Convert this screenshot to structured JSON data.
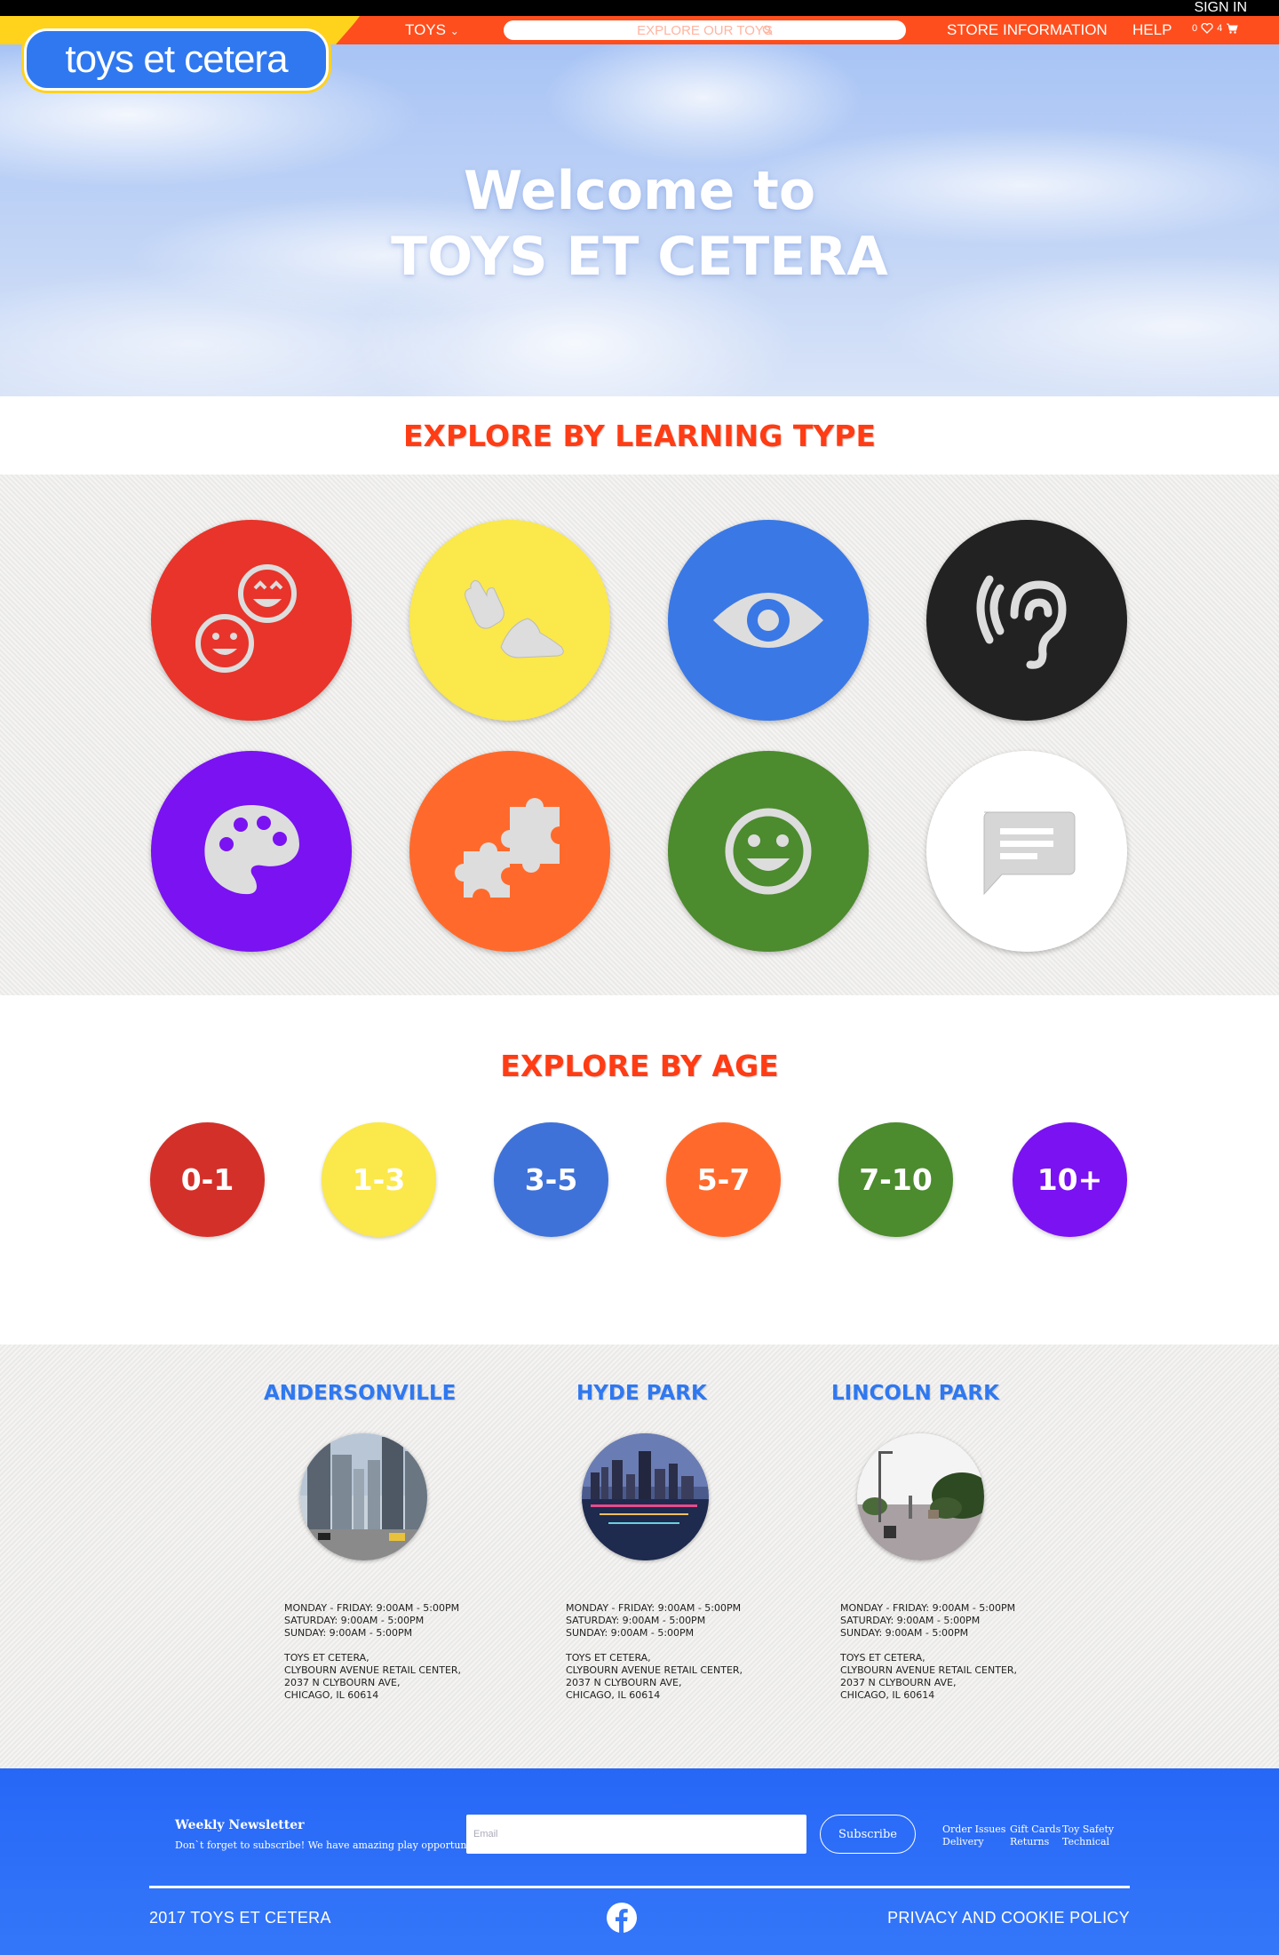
{
  "header": {
    "sign_in": "SIGN IN",
    "logo": "toys et cetera",
    "nav_toys": "TOYS",
    "search_placeholder": "EXPLORE OUR TOYS",
    "nav_store": "STORE INFORMATION",
    "nav_help": "HELP",
    "wishlist_count": "0",
    "cart_count": "4"
  },
  "hero": {
    "line1": "Welcome to",
    "line2": "TOYS ET CETERA"
  },
  "learning": {
    "title": "EXPLORE BY LEARNING TYPE",
    "types": [
      {
        "icon": "social-faces-icon",
        "color": "#e8342a"
      },
      {
        "icon": "hand-foot-icon",
        "color": "#fbe84a"
      },
      {
        "icon": "eye-icon",
        "color": "#3a78e6"
      },
      {
        "icon": "ear-icon",
        "color": "#222222"
      },
      {
        "icon": "palette-icon",
        "color": "#7a12f2"
      },
      {
        "icon": "puzzle-icon",
        "color": "#ff6a2c"
      },
      {
        "icon": "smiley-icon",
        "color": "#4c8b2e"
      },
      {
        "icon": "speech-bubble-icon",
        "color": "#ffffff"
      }
    ]
  },
  "age": {
    "title": "EXPLORE BY AGE",
    "groups": [
      {
        "label": "0-1",
        "color": "#d4302a"
      },
      {
        "label": "1-3",
        "color": "#fbe84a"
      },
      {
        "label": "3-5",
        "color": "#3f72d8"
      },
      {
        "label": "5-7",
        "color": "#ff6a2c"
      },
      {
        "label": "7-10",
        "color": "#4c8b2e"
      },
      {
        "label": "10+",
        "color": "#7a12f2"
      }
    ]
  },
  "stores": [
    {
      "name": "ANDERSONVILLE",
      "hours1": "MONDAY - FRIDAY: 9:00AM - 5:00PM",
      "hours2": "SATURDAY: 9:00AM - 5:00PM",
      "hours3": "SUNDAY: 9:00AM - 5:00PM",
      "addr1": "TOYS ET CETERA,",
      "addr2": "CLYBOURN AVENUE RETAIL CENTER,",
      "addr3": "2037 N CLYBOURN AVE,",
      "addr4": "CHICAGO, IL 60614"
    },
    {
      "name": "HYDE PARK",
      "hours1": "MONDAY - FRIDAY: 9:00AM - 5:00PM",
      "hours2": "SATURDAY: 9:00AM - 5:00PM",
      "hours3": "SUNDAY: 9:00AM - 5:00PM",
      "addr1": "TOYS ET CETERA,",
      "addr2": "CLYBOURN AVENUE RETAIL CENTER,",
      "addr3": "2037 N CLYBOURN AVE,",
      "addr4": "CHICAGO, IL 60614"
    },
    {
      "name": "LINCOLN PARK",
      "hours1": "MONDAY - FRIDAY: 9:00AM - 5:00PM",
      "hours2": "SATURDAY: 9:00AM - 5:00PM",
      "hours3": "SUNDAY: 9:00AM - 5:00PM",
      "addr1": "TOYS ET CETERA,",
      "addr2": "CLYBOURN AVENUE RETAIL CENTER,",
      "addr3": "2037 N CLYBOURN AVE,",
      "addr4": "CHICAGO, IL 60614"
    }
  ],
  "footer": {
    "news_title": "Weekly Newsletter",
    "news_sub": "Don`t forget to subscribe! We have amazing play opportunities!",
    "email_placeholder": "Email",
    "subscribe": "Subscribe",
    "link_order": "Order Issues",
    "link_delivery": "Delivery",
    "link_gift": "Gift Cards",
    "link_returns": "Returns",
    "link_safety": "Toy Safety",
    "link_technical": "Technical",
    "copyright": "2017 TOYS ET CETERA",
    "privacy": "PRIVACY AND COOKIE POLICY"
  }
}
